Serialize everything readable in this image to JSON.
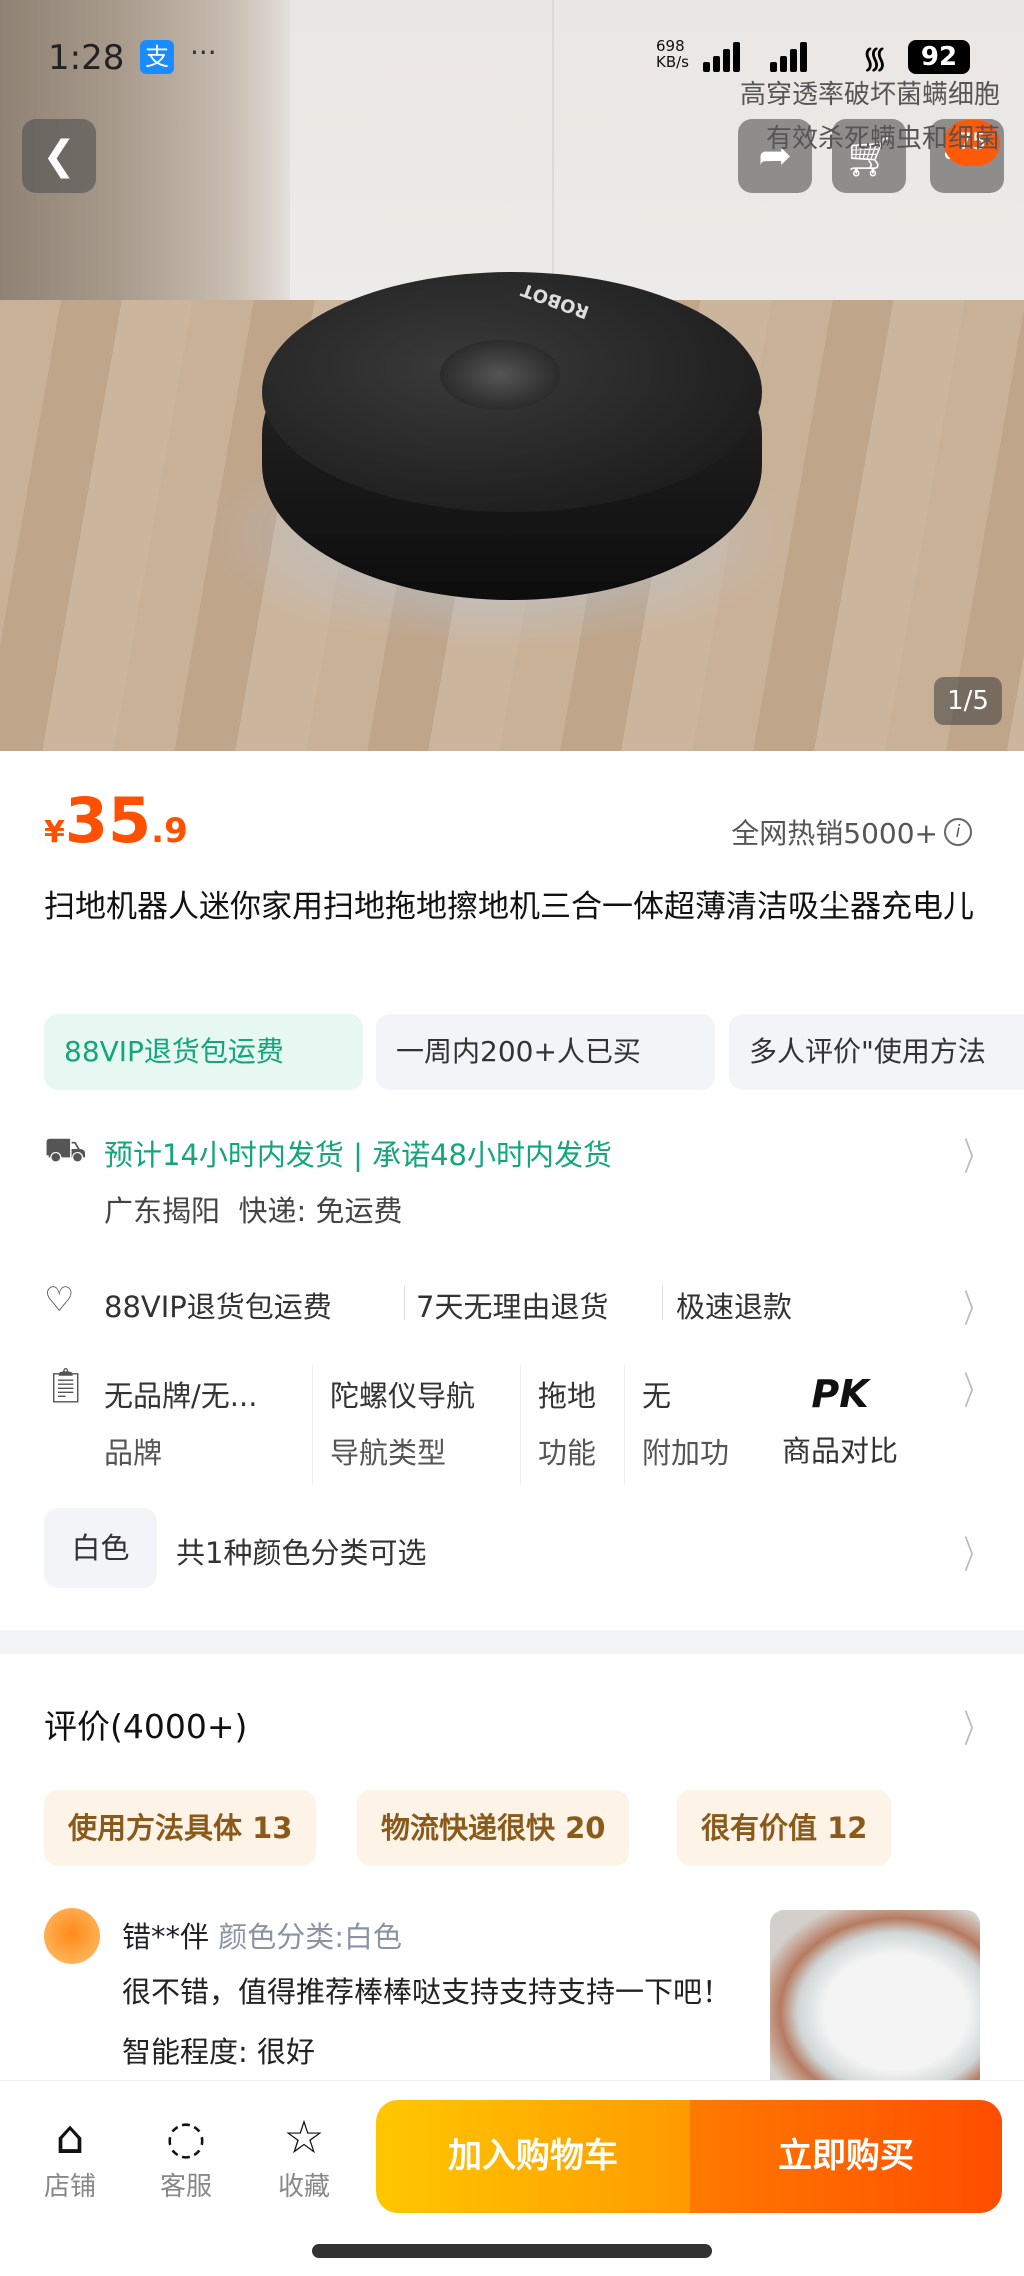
{
  "status_bar": {
    "time": "1:28",
    "app_icon": "支",
    "more": "···",
    "net_speed_value": "698",
    "net_speed_unit": "KB/s",
    "battery": "92"
  },
  "hero": {
    "overlay_line1": "高穿透率破坏菌螨细胞",
    "overlay_line2": "有效杀死螨虫和细菌",
    "robot_label": "ROBOT",
    "pager": "1/5",
    "cart_badge": "75"
  },
  "price": {
    "currency": "¥",
    "integer": "35",
    "decimal": ".9",
    "sales": "全网热销5000+"
  },
  "title": "扫地机器人迷你家用扫地拖地擦地机三合一体超薄清洁吸尘器充电儿",
  "tags": [
    "88VIP退货包运费",
    "一周内200+人已买",
    "多人评价\"使用方法"
  ],
  "delivery": {
    "line1": "预计14小时内发货 | 承诺48小时内发货",
    "origin": "广东揭阳",
    "shipping": "快递: 免运费"
  },
  "guarantees": [
    "88VIP退货包运费",
    "7天无理由退货",
    "极速退款"
  ],
  "specs": [
    {
      "value": "无品牌/无...",
      "label": "品牌"
    },
    {
      "value": "陀螺仪导航",
      "label": "导航类型"
    },
    {
      "value": "拖地",
      "label": "功能"
    },
    {
      "value": "无",
      "label": "附加功"
    }
  ],
  "compare": {
    "logo": "PK",
    "label": "商品对比"
  },
  "color": {
    "chip": "白色",
    "text": "共1种颜色分类可选"
  },
  "reviews": {
    "header": "评价(4000+)",
    "tags": [
      "使用方法具体 13",
      "物流快递很快 20",
      "很有价值 12"
    ],
    "user": "错**伴",
    "variant": "颜色分类:白色",
    "text": "很不错，值得推荐棒棒哒支持支持支持一下吧！ 智能程度: 很好"
  },
  "bottom": {
    "shop": "店铺",
    "service": "客服",
    "favorite": "收藏",
    "add_cart": "加入购物车",
    "buy_now": "立即购买"
  },
  "colors": {
    "accent": "#ff5000",
    "green": "#12a67a"
  }
}
